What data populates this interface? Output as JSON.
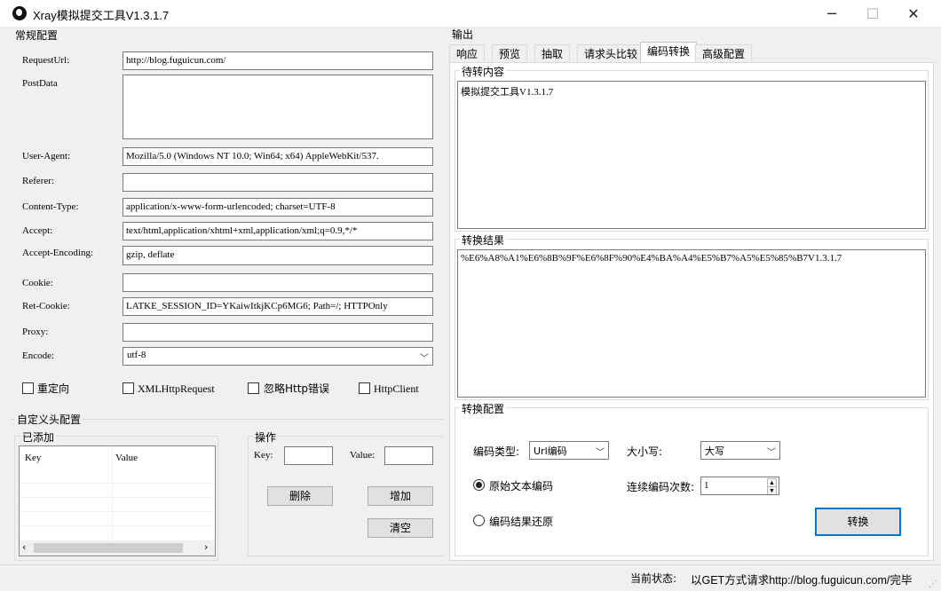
{
  "window": {
    "title": "Xray模拟提交工具V1.3.1.7",
    "minimize_glyph": "─",
    "maximize_glyph": "☐",
    "close_glyph": "✕"
  },
  "left": {
    "group_title": "常规配置",
    "labels": {
      "request_url": "RequestUrl:",
      "post_data": "PostData",
      "user_agent": "User-Agent:",
      "referer": "Referer:",
      "content_type": "Content-Type:",
      "accept": "Accept:",
      "accept_encoding": "Accept-Encoding:",
      "cookie": "Cookie:",
      "ret_cookie": "Ret-Cookie:",
      "proxy": "Proxy:",
      "encode": "Encode:"
    },
    "values": {
      "request_url": "http://blog.fuguicun.com/",
      "post_data": "",
      "user_agent": "Mozilla/5.0 (Windows NT 10.0; Win64; x64) AppleWebKit/537.",
      "referer": "",
      "content_type": "application/x-www-form-urlencoded; charset=UTF-8",
      "accept": "text/html,application/xhtml+xml,application/xml;q=0.9,*/*",
      "accept_encoding": "gzip, deflate",
      "cookie": "",
      "ret_cookie": "LATKE_SESSION_ID=YKaiwItkjKCp6MG6; Path=/; HTTPOnly",
      "proxy": "",
      "encode": "utf-8"
    },
    "checkboxes": {
      "redirect": "重定向",
      "xmlhttp": "XMLHttpRequest",
      "ignore_http_error": "忽略Http错误",
      "httpclient": "HttpClient"
    }
  },
  "custom_header": {
    "group_title": "自定义头配置",
    "added_title": "已添加",
    "columns": [
      "Key",
      "Value"
    ],
    "ops_title": "操作",
    "key_label": "Key:",
    "value_label": "Value:",
    "delete_button": "删除",
    "add_button": "增加",
    "clear_button": "清空"
  },
  "output": {
    "group_title": "输出",
    "tabs": [
      "响应",
      "预览",
      "抽取",
      "请求头比较",
      "编码转换",
      "高级配置"
    ],
    "active_tab": "编码转换",
    "pending_title": "待转内容",
    "pending_text": "模拟提交工具V1.3.1.7",
    "result_title": "转换结果",
    "result_text": "%E6%A8%A1%E6%8B%9F%E6%8F%90%E4%BA%A4%E5%B7%A5%E5%85%B7V1.3.1.7",
    "config_title": "转换配置",
    "encode_type_label": "编码类型:",
    "encode_type_value": "Url编码",
    "case_label": "大小写:",
    "case_value": "大写",
    "radio_original": "原始文本编码",
    "radio_restore": "编码结果还原",
    "repeat_label": "连续编码次数:",
    "repeat_value": "1",
    "convert_button": "转换"
  },
  "status": {
    "label": "当前状态:",
    "text": "以GET方式请求http://blog.fuguicun.com/完毕"
  }
}
